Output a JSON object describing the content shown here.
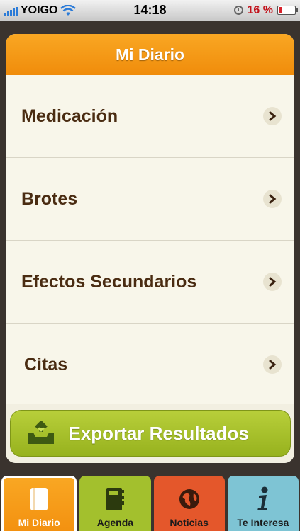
{
  "status_bar": {
    "carrier": "YOIGO",
    "time": "14:18",
    "battery_percent_label": "16 %",
    "battery_level": 0.16
  },
  "header": {
    "title": "Mi Diario"
  },
  "menu": {
    "items": [
      {
        "label": "Medicación"
      },
      {
        "label": "Brotes"
      },
      {
        "label": "Efectos Secundarios"
      },
      {
        "label": "Citas"
      }
    ]
  },
  "export": {
    "label": "Exportar Resultados"
  },
  "tabs": [
    {
      "label": "Mi Diario",
      "icon": "diary-icon",
      "color": "#f5a21b",
      "selected": true
    },
    {
      "label": "Agenda",
      "icon": "agenda-book-icon",
      "color": "#a3c02d"
    },
    {
      "label": "Noticias",
      "icon": "globe-icon",
      "color": "#e4572b"
    },
    {
      "label": "Te Interesa",
      "icon": "info-icon",
      "color": "#7ec4d4"
    }
  ],
  "colors": {
    "accent_orange": "#f5a21b",
    "text_brown": "#4a2c12",
    "card_background": "#f8f6ea",
    "export_green": "#a6c12a"
  }
}
